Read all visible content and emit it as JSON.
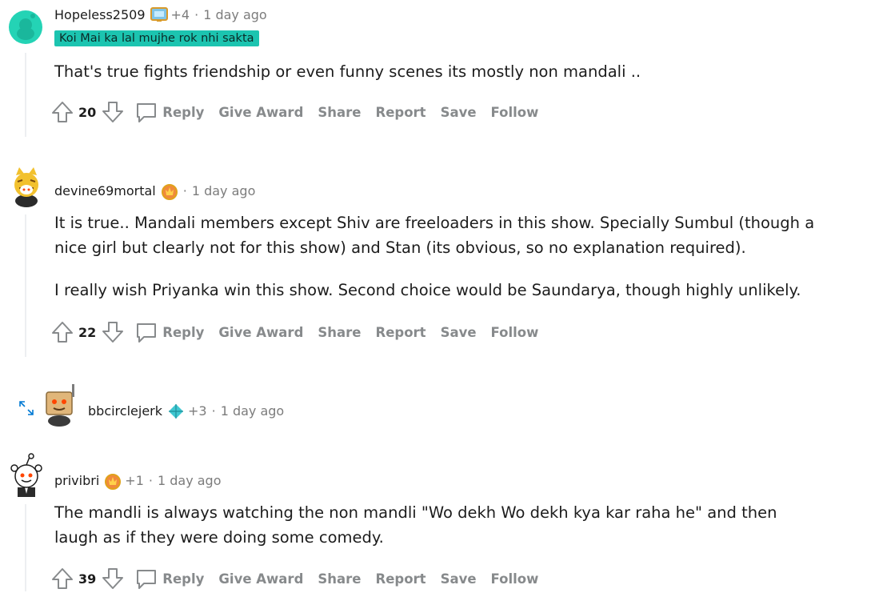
{
  "comments": [
    {
      "username": "Hopeless2509",
      "extra": "+4",
      "time": "1 day ago",
      "flair": "Koi Mai ka lal mujhe rok nhi sakta",
      "paragraphs": [
        "That's true fights friendship or even funny scenes its mostly non mandali .."
      ],
      "score": "20"
    },
    {
      "username": "devine69mortal",
      "time": "1 day ago",
      "paragraphs": [
        "It is true.. Mandali members except Shiv are freeloaders in this show. Specially Sumbul (though a",
        "nice girl but clearly not for this show) and Stan (its obvious, so no explanation required).",
        "I really wish Priyanka win this show. Second choice would be Saundarya, though highly unlikely."
      ],
      "score": "22"
    },
    {
      "username": "bbcirclejerk",
      "extra": "+3",
      "time": "1 day ago",
      "collapsed": true
    },
    {
      "username": "privibri",
      "extra": "+1",
      "time": "1 day ago",
      "paragraphs": [
        "The mandli is always watching the non mandli \"Wo dekh Wo dekh kya kar raha he\" and then",
        "laugh as if they were doing some comedy."
      ],
      "score": "39"
    }
  ],
  "actions": {
    "reply": "Reply",
    "give_award": "Give Award",
    "share": "Share",
    "report": "Report",
    "save": "Save",
    "follow": "Follow"
  },
  "separator": "·",
  "colors": {
    "flair_bg": "#1cc4b0",
    "action_text": "#878a8c",
    "thread_line": "#edeff1"
  }
}
